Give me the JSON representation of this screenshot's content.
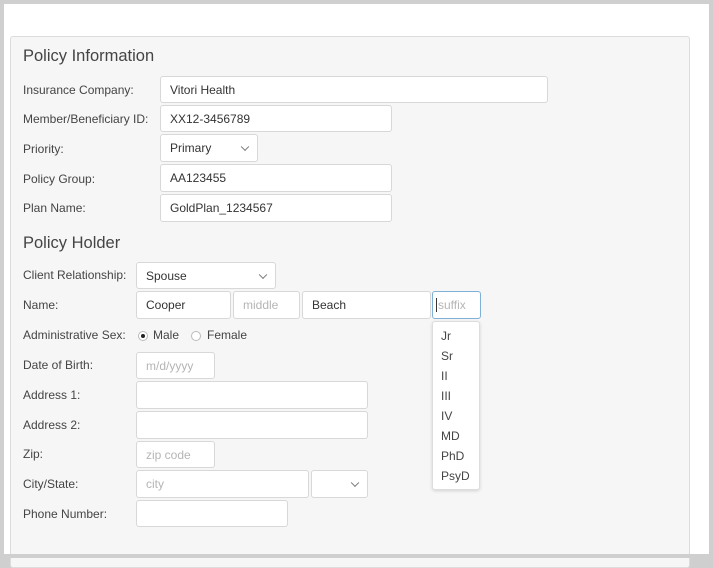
{
  "policy_info": {
    "title": "Policy Information",
    "insurance_company": {
      "label": "Insurance Company:",
      "value": "Vitori Health"
    },
    "member_id": {
      "label": "Member/Beneficiary ID:",
      "value": "XX12-3456789"
    },
    "priority": {
      "label": "Priority:",
      "value": "Primary"
    },
    "policy_group": {
      "label": "Policy Group:",
      "value": "AA123455"
    },
    "plan_name": {
      "label": "Plan Name:",
      "value": "GoldPlan_1234567"
    }
  },
  "policy_holder": {
    "title": "Policy Holder",
    "client_relationship": {
      "label": "Client Relationship:",
      "value": "Spouse"
    },
    "name": {
      "label": "Name:",
      "first": "Cooper",
      "middle_placeholder": "middle",
      "last": "Beach",
      "suffix_placeholder": "suffix"
    },
    "sex": {
      "label": "Administrative Sex:",
      "options": [
        "Male",
        "Female"
      ],
      "selected": "Male"
    },
    "dob": {
      "label": "Date of Birth:",
      "placeholder": "m/d/yyyy"
    },
    "address1": {
      "label": "Address 1:"
    },
    "address2": {
      "label": "Address 2:"
    },
    "zip": {
      "label": "Zip:",
      "placeholder": "zip code"
    },
    "city_state": {
      "label": "City/State:",
      "city_placeholder": "city"
    },
    "phone": {
      "label": "Phone Number:"
    }
  },
  "suffix_options": [
    "Jr",
    "Sr",
    "II",
    "III",
    "IV",
    "MD",
    "PhD",
    "PsyD"
  ]
}
